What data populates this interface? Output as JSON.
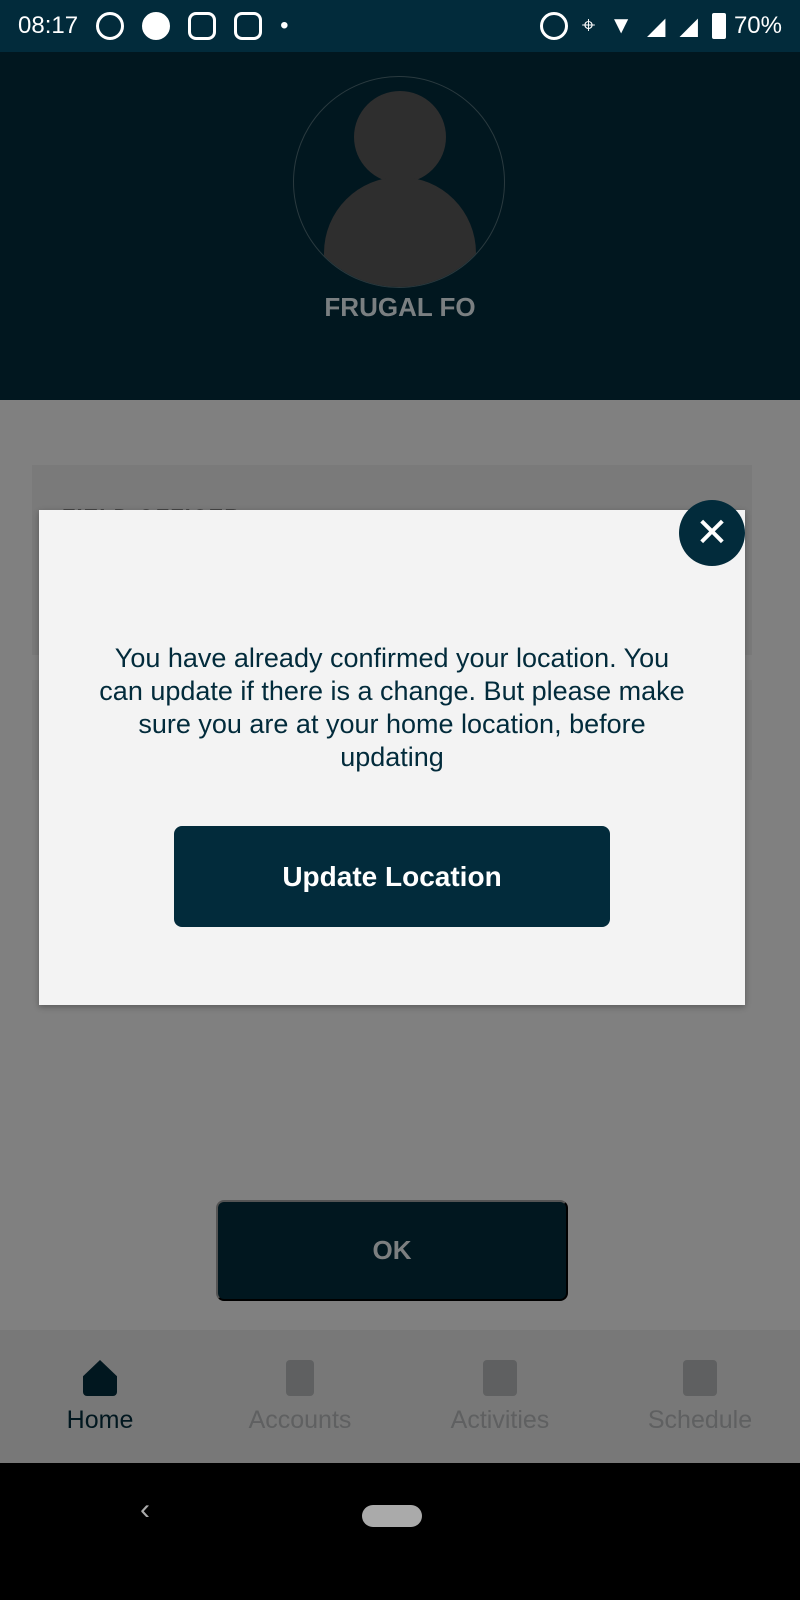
{
  "status_bar": {
    "time": "08:17",
    "battery": "70%",
    "icons": [
      "whatsapp-icon",
      "messages-icon",
      "instagram-icon",
      "instagram-icon",
      "dot-icon",
      "alarm-icon",
      "location-icon",
      "data-arrows-icon",
      "wifi-icon",
      "signal-icon",
      "signal-icon",
      "battery-icon"
    ]
  },
  "profile": {
    "name": "FRUGAL FO"
  },
  "card": {
    "label": "FIELD OFFICER"
  },
  "modal": {
    "message": "You have already confirmed your location. You can update if there is a change. But please make sure you are at your home location, before updating",
    "update_label": "Update Location",
    "close_icon": "close-icon"
  },
  "ok_label": "OK",
  "nav": {
    "items": [
      {
        "label": "Home",
        "icon": "home-icon"
      },
      {
        "label": "Accounts",
        "icon": "document-icon"
      },
      {
        "label": "Activities",
        "icon": "activities-grid-icon"
      },
      {
        "label": "Schedule",
        "icon": "calendar-clock-icon"
      }
    ]
  },
  "colors": {
    "primary": "#022b3b",
    "overlay": "#808080",
    "modal_bg": "#f3f3f3"
  }
}
